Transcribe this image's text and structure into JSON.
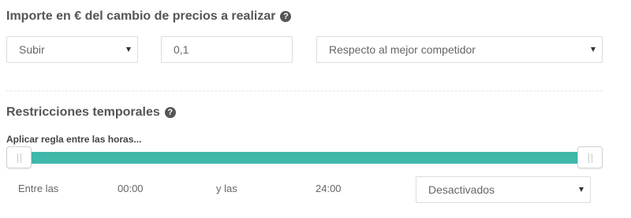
{
  "price_change": {
    "title": "Importe en € del cambio de precios a realizar",
    "help_icon": "?",
    "direction": {
      "selected": "Subir"
    },
    "amount": {
      "value": "0,1",
      "placeholder": ""
    },
    "reference": {
      "selected": "Respecto al mejor competidor"
    }
  },
  "time_restrictions": {
    "title": "Restricciones temporales",
    "help_icon": "?",
    "slider_label": "Aplicar regla entre las horas...",
    "range": {
      "start_fraction": 0.0,
      "end_fraction": 1.0
    },
    "from_label": "Entre las",
    "from_value": "00:00",
    "to_label": "y las",
    "to_value": "24:00",
    "status": {
      "selected": "Desactivados"
    }
  },
  "colors": {
    "slider_fill": "#3fb8a9",
    "text": "#555555"
  }
}
